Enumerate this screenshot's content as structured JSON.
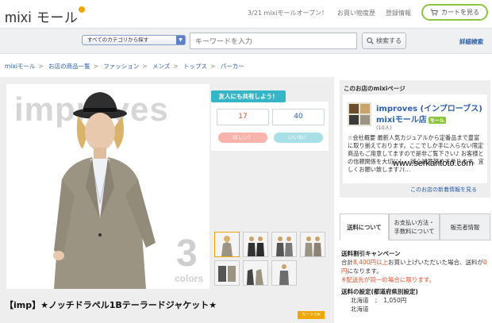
{
  "header": {
    "logo_text": "mixi",
    "logo_suffix": "モール",
    "announce": "3/21 mixiモールオープン！",
    "link_beginner": "お買い物度歴",
    "link_register": "登録情報",
    "cart_label": "カートを見る"
  },
  "search": {
    "category": "すべてのカテゴリから探す",
    "placeholder": "キーワードを入力",
    "button_label": "検索する",
    "advanced": "詳細検索"
  },
  "breadcrumb": [
    "mixiモール",
    "お店の商品一覧",
    "ファッション",
    "メンズ",
    "トップス",
    "パーカー"
  ],
  "product": {
    "brand_watermark": "improves",
    "colors_number": "3",
    "colors_label": "colors",
    "title": "【imp】★ノッチドラペル1Bテーラードジャケット★",
    "cart_ok": "カートOK"
  },
  "share": {
    "header": "友人にも共有しよう！",
    "count_want": "17",
    "count_like": "40",
    "want_label": "ほしい！",
    "like_label": "いいね！"
  },
  "shop": {
    "panel_title": "このお店のmixiページ",
    "name_line1": "improves (インプローブス)",
    "name_line2": "mixiモール店",
    "mall_badge": "モール",
    "member_count": "(10人)",
    "description": "☆会社概要 最新人気カジュアルから定番品まで豊富に取り揃えております。ここでしか手に入らない限定商品もご用意してますので是非ご覧下さい♪ お客様との信頼関係を大切にし、誠心誠意努めて参ります。宜しくお願い致します♪(…",
    "new_arrivals": "このお店の新着情報を見る"
  },
  "tabs": [
    {
      "label": "送料について",
      "active": true
    },
    {
      "label": "お支払い方法・手数料について",
      "active": false
    },
    {
      "label": "販売者情報",
      "active": false
    }
  ],
  "shipping": {
    "campaign_title": "送料割引キャンペーン",
    "campaign_pre": "合計",
    "campaign_amount": "8,400円以上",
    "campaign_mid": "お買い上げいただいた場合、送料が",
    "campaign_free": "0円",
    "campaign_post": "になります。",
    "note": "※配送先が同一の場合に限ります。",
    "region_title": "送料の設定(都道府県別設定)",
    "region_name": "北海道",
    "region_price": "1,050円",
    "region_row2": "北海道"
  },
  "watermark_text": "www.serkantoto.com",
  "colors": {
    "accent_green": "#8cc63f",
    "share_teal": "#35b6c6",
    "link_blue": "#2a5fb0",
    "price_red": "#e4502b",
    "cart_ok_orange": "#f0a500"
  }
}
